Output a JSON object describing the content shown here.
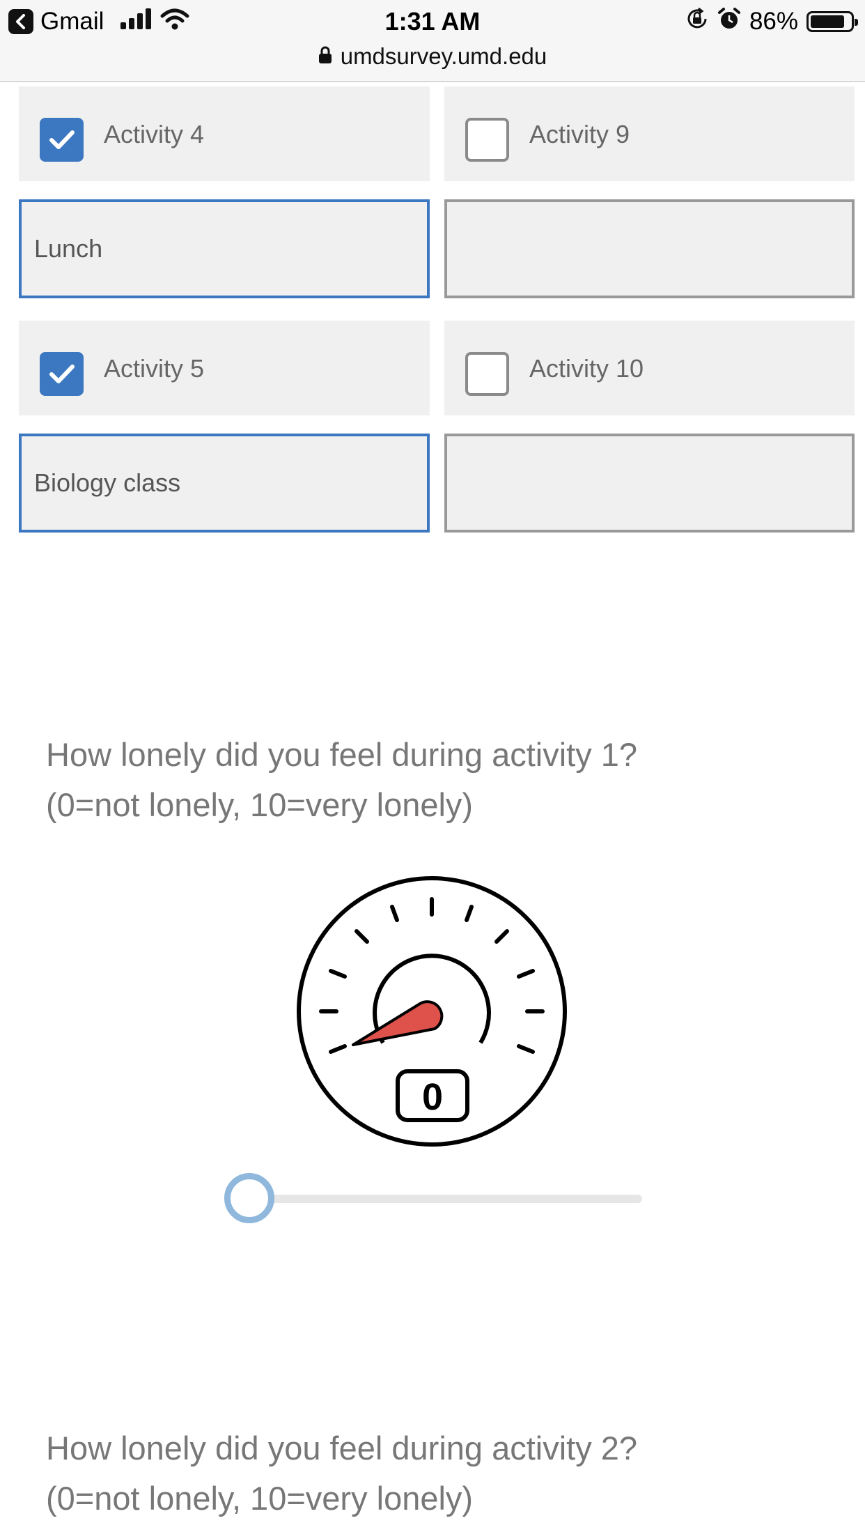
{
  "status_bar": {
    "back_app": "Gmail",
    "time": "1:31 AM",
    "battery": "86%",
    "battery_level": 0.86,
    "url": "umdsurvey.umd.edu",
    "icons": [
      "signal-bars-icon",
      "wifi-icon",
      "orientation-lock-icon",
      "alarm-icon",
      "battery-icon",
      "lock-icon"
    ]
  },
  "activities": {
    "rows": [
      {
        "left": {
          "label": "Activity 4",
          "checked": true,
          "input_value": "Lunch"
        },
        "right": {
          "label": "Activity 9",
          "checked": false,
          "input_value": ""
        }
      },
      {
        "left": {
          "label": "Activity 5",
          "checked": true,
          "input_value": "Biology class"
        },
        "right": {
          "label": "Activity 10",
          "checked": false,
          "input_value": ""
        }
      }
    ]
  },
  "questions": [
    {
      "line1": "How lonely did you feel during activity 1?",
      "line2": "(0=not lonely, 10=very lonely)",
      "gauge_value": "0",
      "slider_value": 0,
      "slider_min": 0,
      "slider_max": 10
    },
    {
      "line1": "How lonely did you feel during activity 2?",
      "line2": "(0=not lonely, 10=very lonely)"
    }
  ],
  "colors": {
    "accent": "#3b78c1",
    "cell_bg": "#f0f0f0",
    "gauge_needle": "#de524b",
    "slider_thumb": "#8fb8dc"
  }
}
